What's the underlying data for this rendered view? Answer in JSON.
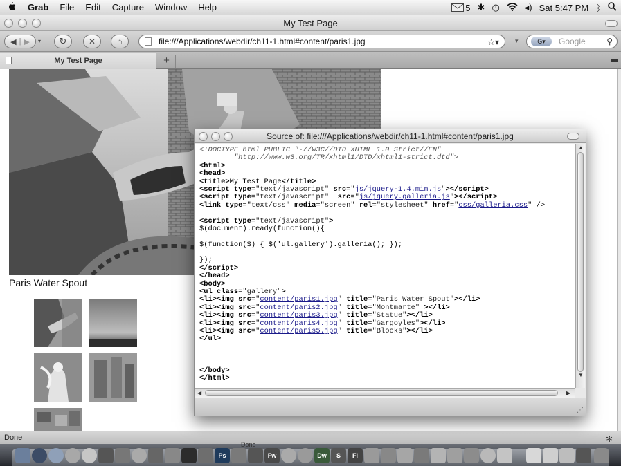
{
  "menubar": {
    "apple_icon": "apple-icon",
    "items": [
      "Grab",
      "File",
      "Edit",
      "Capture",
      "Window",
      "Help"
    ],
    "status": {
      "mail_count": "5",
      "clock": "Sat 5:47 PM"
    }
  },
  "browser": {
    "title": "My Test Page",
    "url": "file:///Applications/webdir/ch11-1.html#content/paris1.jpg",
    "search_placeholder": "Google",
    "tab_label": "My Test Page",
    "new_tab_label": "+",
    "status_text": "Done"
  },
  "page": {
    "caption": "Paris Water Spout"
  },
  "source_window": {
    "title": "Source of: file:///Applications/webdir/ch11-1.html#content/paris1.jpg"
  },
  "dock": {
    "labels": [
      "Ps",
      "Fw",
      "Dw",
      "S",
      "Fl"
    ],
    "hover_label": "Done"
  },
  "colors": {
    "menubar": "#e8e8e8",
    "chrome": "#c8c8c8",
    "link": "#1a1a8a"
  }
}
